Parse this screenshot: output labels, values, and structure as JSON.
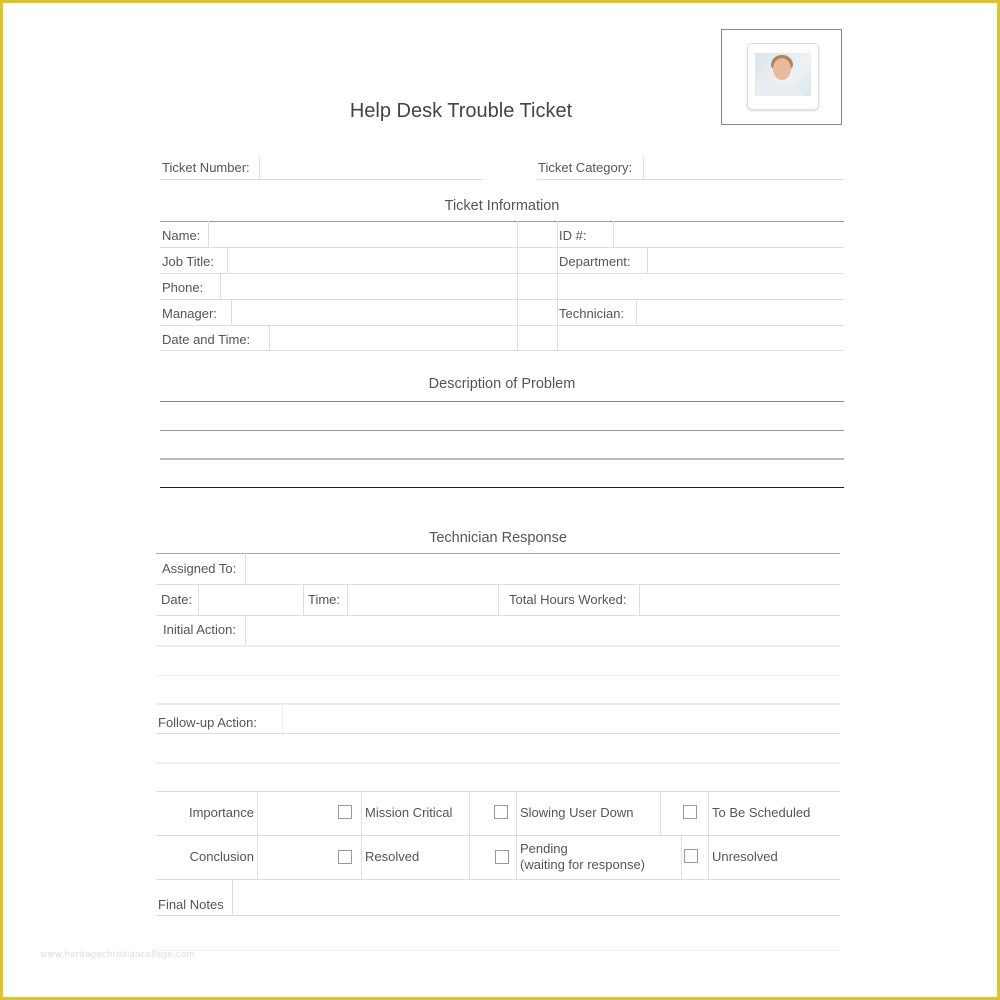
{
  "title": "Help Desk Trouble Ticket",
  "photo": {
    "icon": "user-photo-icon"
  },
  "header_fields": {
    "ticket_number": {
      "label": "Ticket Number:",
      "value": ""
    },
    "ticket_category": {
      "label": "Ticket Category:",
      "value": ""
    }
  },
  "ticket_information": {
    "heading": "Ticket Information",
    "left": [
      {
        "label": "Name:",
        "value": ""
      },
      {
        "label": "Job Title:",
        "value": ""
      },
      {
        "label": "Phone:",
        "value": ""
      },
      {
        "label": "Manager:",
        "value": ""
      },
      {
        "label": "Date and Time:",
        "value": ""
      }
    ],
    "right": [
      {
        "label": "ID #:",
        "value": ""
      },
      {
        "label": "Department:",
        "value": ""
      },
      {
        "label": "",
        "value": ""
      },
      {
        "label": "Technician:",
        "value": ""
      },
      {
        "label": "",
        "value": ""
      }
    ]
  },
  "description": {
    "heading": "Description of Problem",
    "lines": [
      "",
      "",
      ""
    ]
  },
  "technician_response": {
    "heading": "Technician Response",
    "assigned_to": {
      "label": "Assigned To:",
      "value": ""
    },
    "date": {
      "label": "Date:",
      "value": ""
    },
    "time": {
      "label": "Time:",
      "value": ""
    },
    "total_hours": {
      "label": "Total Hours Worked:",
      "value": ""
    },
    "initial_action": {
      "label": "Initial Action:",
      "value": ""
    },
    "followup_action": {
      "label": "Follow-up Action:",
      "value": ""
    }
  },
  "importance": {
    "label": "Importance",
    "options": [
      {
        "label": "Mission Critical",
        "checked": false
      },
      {
        "label": "Slowing User Down",
        "checked": false
      },
      {
        "label": "To Be Scheduled",
        "checked": false
      }
    ]
  },
  "conclusion": {
    "label": "Conclusion",
    "options": [
      {
        "label": "Resolved",
        "checked": false
      },
      {
        "label": "Pending",
        "sublabel": "(waiting for response)",
        "checked": false
      },
      {
        "label": "Unresolved",
        "checked": false
      }
    ]
  },
  "final_notes": {
    "label": "Final Notes",
    "value": ""
  },
  "watermark": "www.heritagechristiancollege.com"
}
